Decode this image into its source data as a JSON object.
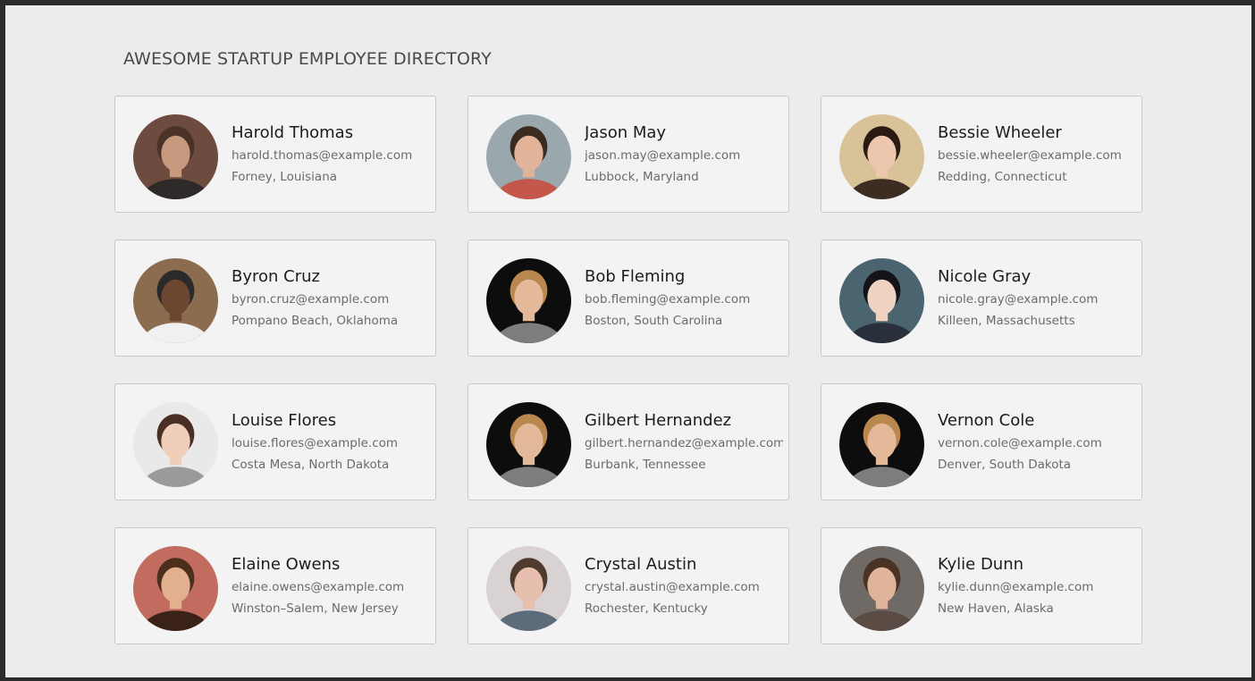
{
  "page": {
    "title": "AWESOME STARTUP EMPLOYEE DIRECTORY"
  },
  "employees": [
    {
      "name": "Harold Thomas",
      "email": "harold.thomas@example.com",
      "location": "Forney, Louisiana",
      "avatar": {
        "bg": "#6d4b3e",
        "skin": "#c79a80",
        "hair": "#4a3226",
        "shirt": "#2f2a2a"
      }
    },
    {
      "name": "Jason May",
      "email": "jason.may@example.com",
      "location": "Lubbock, Maryland",
      "avatar": {
        "bg": "#9aa7ad",
        "skin": "#e1b39a",
        "hair": "#3b2a20",
        "shirt": "#c4574a"
      }
    },
    {
      "name": "Bessie Wheeler",
      "email": "bessie.wheeler@example.com",
      "location": "Redding, Connecticut",
      "avatar": {
        "bg": "#d8c298",
        "skin": "#ecc6ad",
        "hair": "#2a1a12",
        "shirt": "#3c2c22"
      }
    },
    {
      "name": "Byron Cruz",
      "email": "byron.cruz@example.com",
      "location": "Pompano Beach, Oklahoma",
      "avatar": {
        "bg": "#8b6c4e",
        "skin": "#6b4631",
        "hair": "#2a2a2a",
        "shirt": "#f0f0f0"
      }
    },
    {
      "name": "Bob Fleming",
      "email": "bob.fleming@example.com",
      "location": "Boston, South Carolina",
      "avatar": {
        "bg": "#0d0d0d",
        "skin": "#e3b99a",
        "hair": "#b8884f",
        "shirt": "#7d7d7d"
      }
    },
    {
      "name": "Nicole Gray",
      "email": "nicole.gray@example.com",
      "location": "Killeen, Massachusetts",
      "avatar": {
        "bg": "#4b6570",
        "skin": "#f0d2c2",
        "hair": "#141418",
        "shirt": "#2a2f3c"
      }
    },
    {
      "name": "Louise Flores",
      "email": "louise.flores@example.com",
      "location": "Costa Mesa, North Dakota",
      "avatar": {
        "bg": "#e9e9e9",
        "skin": "#efcfba",
        "hair": "#4a3024",
        "shirt": "#9a9a9a"
      }
    },
    {
      "name": "Gilbert Hernandez",
      "email": "gilbert.hernandez@example.com",
      "location": "Burbank, Tennessee",
      "avatar": {
        "bg": "#0d0d0d",
        "skin": "#e3b99a",
        "hair": "#b8884f",
        "shirt": "#7d7d7d"
      }
    },
    {
      "name": "Vernon Cole",
      "email": "vernon.cole@example.com",
      "location": "Denver, South Dakota",
      "avatar": {
        "bg": "#0d0d0d",
        "skin": "#e3b99a",
        "hair": "#b8884f",
        "shirt": "#7d7d7d"
      }
    },
    {
      "name": "Elaine Owens",
      "email": "elaine.owens@example.com",
      "location": "Winston–Salem, New Jersey",
      "avatar": {
        "bg": "#c26c60",
        "skin": "#e2b08f",
        "hair": "#4b2e1c",
        "shirt": "#3a2218"
      }
    },
    {
      "name": "Crystal Austin",
      "email": "crystal.austin@example.com",
      "location": "Rochester, Kentucky",
      "avatar": {
        "bg": "#d9d2d2",
        "skin": "#e6bfae",
        "hair": "#4f3a2e",
        "shirt": "#5d6b7a"
      }
    },
    {
      "name": "Kylie Dunn",
      "email": "kylie.dunn@example.com",
      "location": "New Haven, Alaska",
      "avatar": {
        "bg": "#6f6a66",
        "skin": "#e0b49a",
        "hair": "#4a3224",
        "shirt": "#5a4b44"
      }
    }
  ]
}
